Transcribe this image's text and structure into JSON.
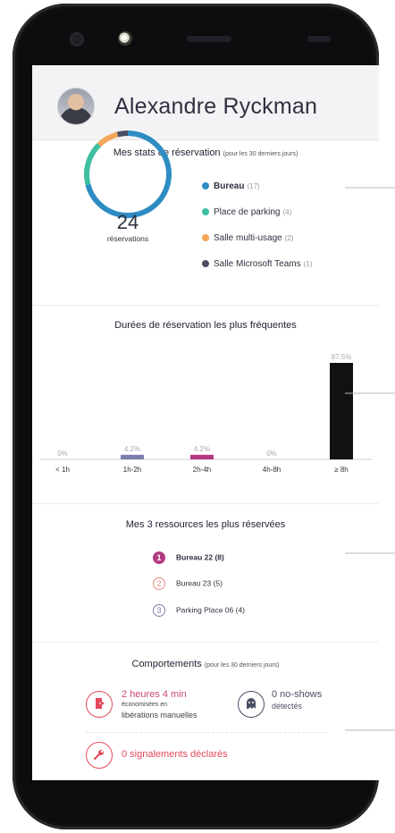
{
  "user": {
    "name": "Alexandre Ryckman"
  },
  "colors": {
    "bureau": "#2e8cc4",
    "parking": "#3dbfa0",
    "salle_multi": "#f4a75a",
    "salle_teams": "#4b4e63",
    "rank1": "#b23a82",
    "rank2": "#e58a80",
    "rank3": "#7b7dae",
    "accent_red": "#e2495a",
    "bar_dark": "#111111"
  },
  "stats": {
    "title": "Mes stats de réservation",
    "note": "(pour les 30 derniers jours)",
    "total": "24",
    "unit": "réservations",
    "legend": [
      {
        "label": "Bureau",
        "count": "(17)",
        "icon": "bureau-dot"
      },
      {
        "label": "Place de parking",
        "count": "(4)",
        "icon": "parking-dot"
      },
      {
        "label": "Salle multi-usage",
        "count": "(2)",
        "icon": "salle-multi-dot"
      },
      {
        "label": "Salle Microsoft Teams",
        "count": "(1)",
        "icon": "salle-teams-dot"
      }
    ]
  },
  "chart_data": {
    "type": "bar",
    "title": "Durées de réservation les plus fréquentes",
    "categories": [
      "< 1h",
      "1h-2h",
      "2h-4h",
      "4h-8h",
      "≥ 8h"
    ],
    "values": [
      0,
      4.2,
      4.2,
      0,
      87.5
    ],
    "value_labels": [
      "0%",
      "4.2%",
      "4.2%",
      "0%",
      "87.5%"
    ],
    "ylim": [
      0,
      87.5
    ],
    "grid": false
  },
  "resources": {
    "title": "Mes 3 ressources les plus réservées",
    "items": [
      {
        "rank": "1",
        "label": "Bureau 22 (8)"
      },
      {
        "rank": "2",
        "label": "Bureau 23 (5)"
      },
      {
        "rank": "3",
        "label": "Parking Place 06 (4)"
      }
    ]
  },
  "behaviours": {
    "title": "Comportements",
    "note": "(pour les 30 derniers jours)",
    "saved_time": "2 heures 4 min",
    "saved_sub": "économisées en",
    "saved_label": "libérations manuelles",
    "no_shows": "0 no-shows",
    "no_shows_sub": "détectés",
    "reports": "0 signalements déclarés",
    "icons": [
      "door-exit-icon",
      "ghost-icon",
      "wrench-icon"
    ]
  }
}
